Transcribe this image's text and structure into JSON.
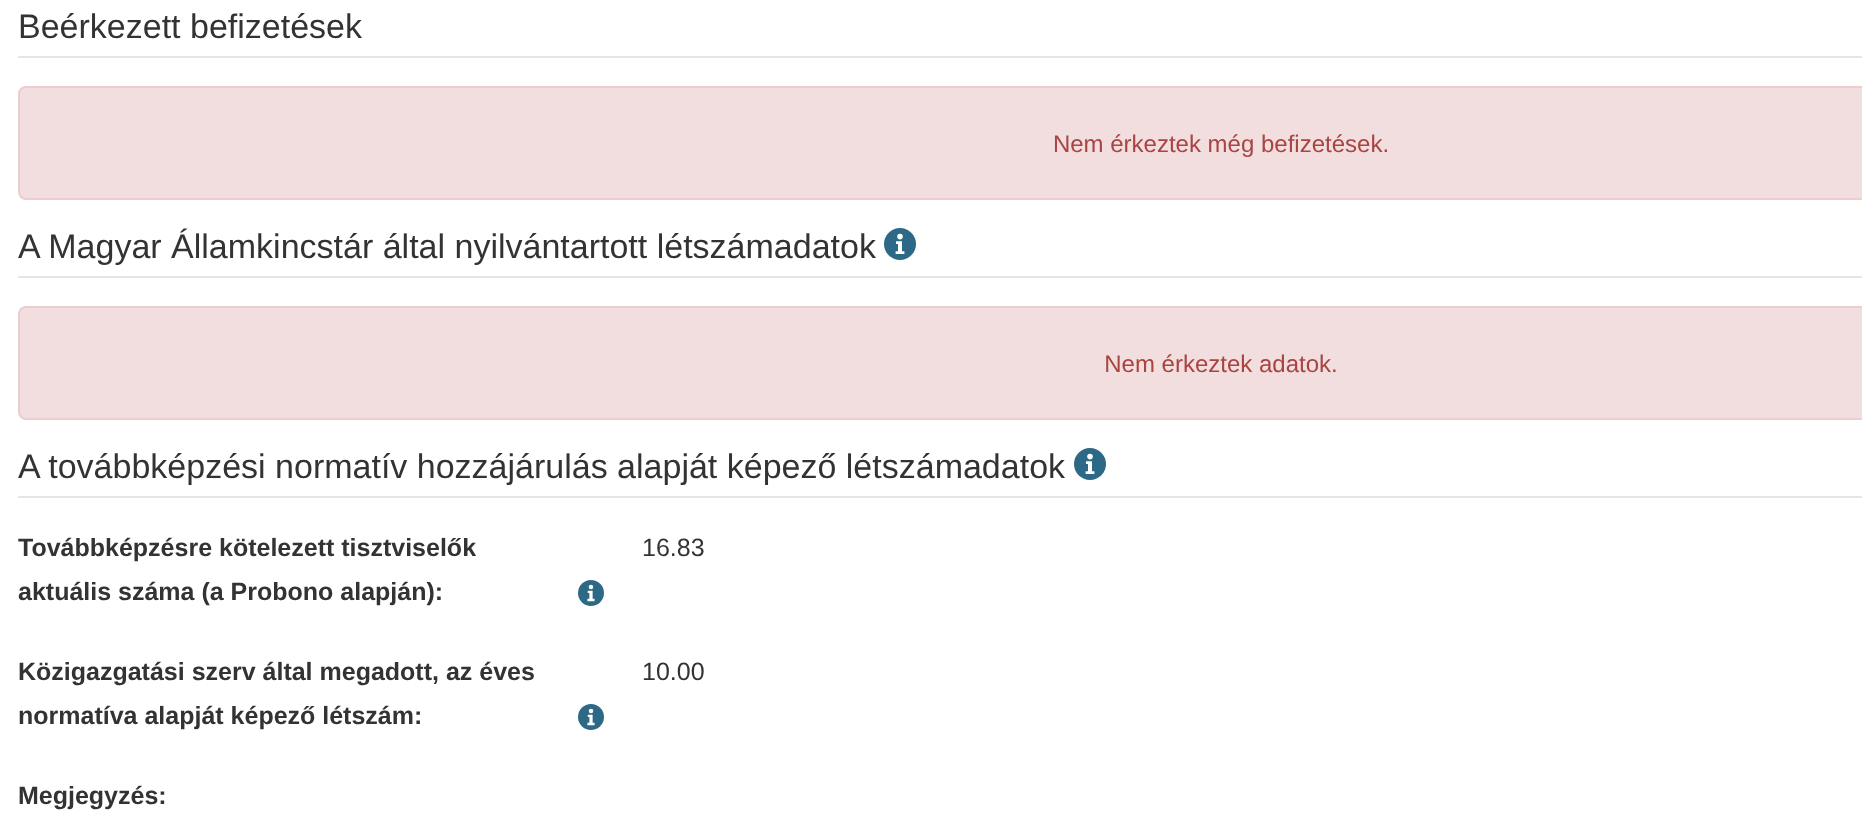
{
  "sections": [
    {
      "kind": "alert",
      "title": "Beérkezett befizetések",
      "info": false,
      "message": "Nem érkeztek még befizetések."
    },
    {
      "kind": "alert",
      "title": "A Magyar Államkincstár által nyilvántartott létszámadatok",
      "info": true,
      "message": "Nem érkeztek adatok."
    },
    {
      "kind": "fields",
      "title": "A továbbképzési normatív hozzájárulás alapját képező létszámadatok",
      "info": true,
      "fields": [
        {
          "label": "Továbbképzésre kötelezett tisztviselők aktuális száma (a Probono alapján):",
          "info": true,
          "value": "16.83"
        },
        {
          "label": "Közigazgatási szerv által megadott, az éves normatíva alapját képező létszám:",
          "info": true,
          "value": "10.00"
        },
        {
          "label": "Megjegyzés:",
          "info": false
        }
      ]
    }
  ]
}
